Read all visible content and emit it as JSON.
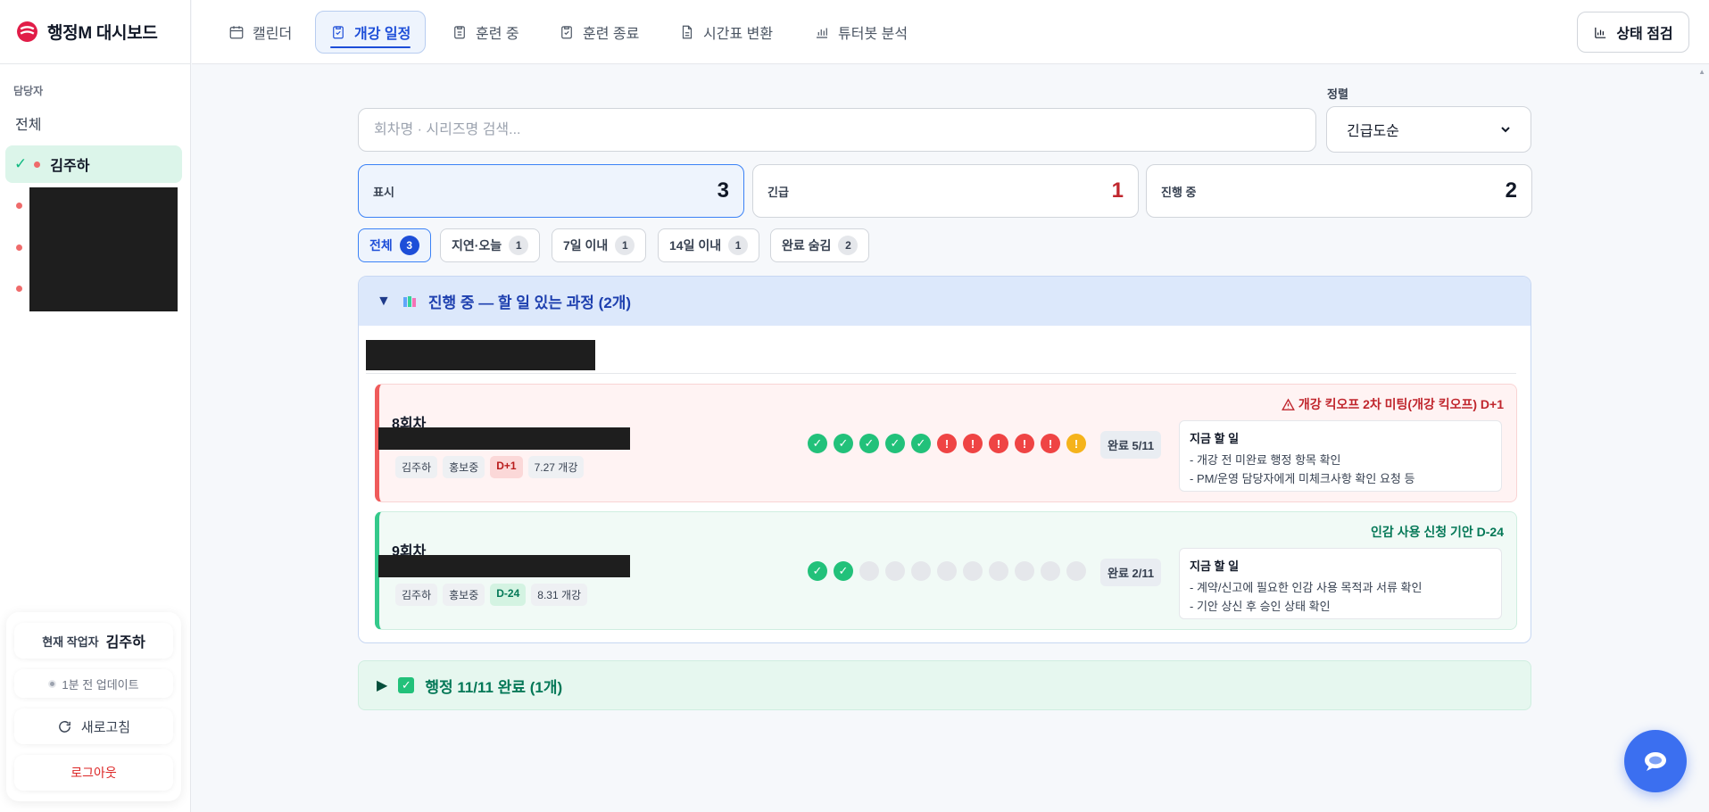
{
  "brand": {
    "title": "행정M 대시보드"
  },
  "nav": {
    "tabs": [
      {
        "label": "캘린더",
        "icon": "calendar-icon"
      },
      {
        "label": "개강 일정",
        "icon": "clipboard-check-icon"
      },
      {
        "label": "훈련 중",
        "icon": "clipboard-icon"
      },
      {
        "label": "훈련 종료",
        "icon": "clipboard-check-icon"
      },
      {
        "label": "시간표 변환",
        "icon": "document-icon"
      },
      {
        "label": "튜터봇 분석",
        "icon": "bar-chart-icon"
      }
    ],
    "status_button": "상태 점검"
  },
  "sidebar": {
    "section_label": "담당자",
    "all_label": "전체",
    "active_person": "김주하",
    "worker_label": "현재 작업자",
    "worker_name": "김주하",
    "updated": "1분 전 업데이트",
    "refresh": "새로고침",
    "logout": "로그아웃"
  },
  "search": {
    "placeholder": "회차명 · 시리즈명 검색..."
  },
  "sort": {
    "label": "정렬",
    "value": "긴급도순"
  },
  "stats": [
    {
      "label": "표시",
      "value": "3"
    },
    {
      "label": "긴급",
      "value": "1"
    },
    {
      "label": "진행 중",
      "value": "2"
    }
  ],
  "filters": [
    {
      "label": "전체",
      "count": "3"
    },
    {
      "label": "지연·오늘",
      "count": "1"
    },
    {
      "label": "7일 이내",
      "count": "1"
    },
    {
      "label": "14일 이내",
      "count": "1"
    },
    {
      "label": "완료 숨김",
      "count": "2"
    }
  ],
  "group": {
    "title": "진행 중 — 할 일 있는 과정 (2개)",
    "courses": [
      {
        "round": "8회차",
        "tags": [
          "김주하",
          "홍보중",
          "D+1",
          "7.27 개강"
        ],
        "progress": "완료 5/11",
        "alert": "개강 킥오프 2차 미팅(개강 킥오프) D+1",
        "todo_title": "지금 할 일",
        "todos": [
          "- 개강 전 미완료 행정 항목 확인",
          "- PM/운영 담당자에게 미체크사항 확인 요청 등"
        ]
      },
      {
        "round": "9회차",
        "tags": [
          "김주하",
          "홍보중",
          "D-24",
          "8.31 개강"
        ],
        "progress": "완료 2/11",
        "alert": "인감 사용 신청 기안 D-24",
        "todo_title": "지금 할 일",
        "todos": [
          "- 계약/신고에 필요한 인감 사용 목적과 서류 확인",
          "- 기안 상신 후 승인 상태 확인"
        ]
      }
    ]
  },
  "done_group": {
    "title": "행정 11/11 완료 (1개)"
  },
  "colors": {
    "accent": "#1d4ed8",
    "urgent": "#c0262d",
    "ok": "#047857",
    "fab": "#3b6ff0"
  }
}
